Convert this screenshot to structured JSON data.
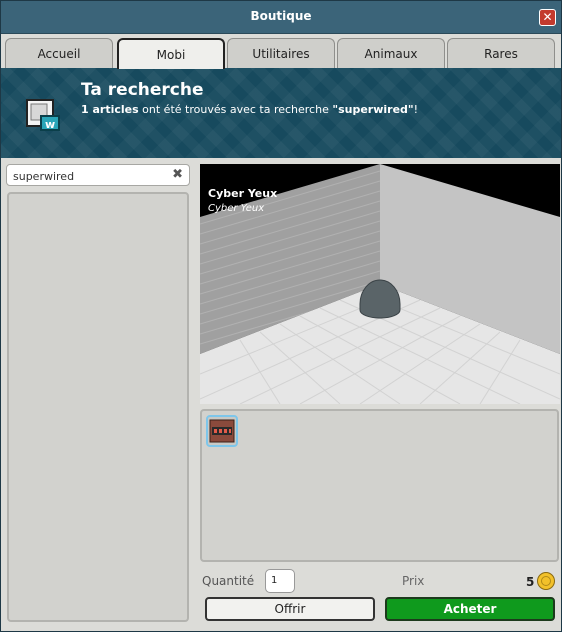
{
  "window": {
    "title": "Boutique"
  },
  "tabs": [
    {
      "label": "Accueil",
      "active": false
    },
    {
      "label": "Mobi",
      "active": true
    },
    {
      "label": "Utilitaires",
      "active": false
    },
    {
      "label": "Animaux",
      "active": false
    },
    {
      "label": "Rares",
      "active": false
    }
  ],
  "banner": {
    "title": "Ta recherche",
    "count": "1 articles",
    "text": " ont été trouvés avec ta recherche ",
    "query_quoted": "\"superwired\"",
    "suffix": "!"
  },
  "search": {
    "value": "superwired"
  },
  "preview": {
    "name": "Cyber Yeux",
    "description": "Cyber Yeux"
  },
  "purchase": {
    "quantity_label": "Quantité",
    "quantity": "1",
    "price_label": "Prix",
    "price": "5",
    "offer_label": "Offrir",
    "buy_label": "Acheter"
  }
}
